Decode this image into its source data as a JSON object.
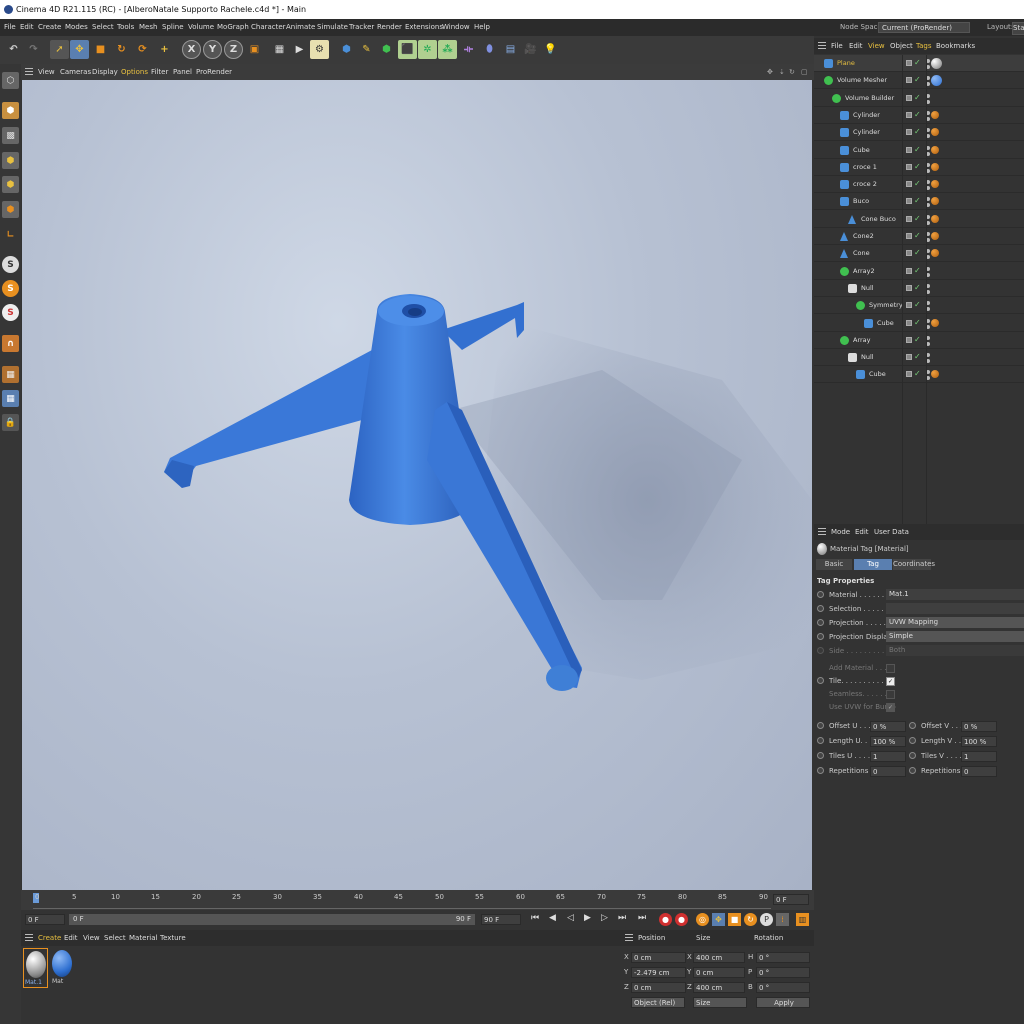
{
  "window": {
    "title": "Cinema 4D R21.115 (RC) - [AlberoNatale Supporto Rachele.c4d *] - Main"
  },
  "menu": {
    "items": [
      "File",
      "Edit",
      "Create",
      "Modes",
      "Select",
      "Tools",
      "Mesh",
      "Spline",
      "Volume",
      "MoGraph",
      "Character",
      "Animate",
      "Simulate",
      "Tracker",
      "Render",
      "Extensions",
      "Window",
      "Help"
    ],
    "node_space_label": "Node Space:",
    "node_space_value": "Current (ProRender)",
    "layout_label": "Layout:",
    "layout_value": "Star"
  },
  "toolbar": {
    "axis": [
      "X",
      "Y",
      "Z"
    ],
    "colors": {
      "active": "#5a7fb0",
      "yellow": "#e8c040",
      "orange": "#e89020",
      "blue": "#4a8fd8",
      "green": "#40c050"
    }
  },
  "left_tools": {
    "icons": [
      "make-editable-icon",
      "model-mode-icon",
      "texture-mode-icon",
      "points-mode-icon",
      "edges-mode-icon",
      "polygons-mode-icon",
      "axis-mode-icon",
      "snap-s-icon",
      "snap-s-icon",
      "snap-s-icon",
      "magnet-icon",
      "grid-icon",
      "grid-icon",
      "lock-icon"
    ],
    "snap_glyph": "S"
  },
  "viewport": {
    "menu": [
      "View",
      "Cameras",
      "Display",
      "Options",
      "Filter",
      "Panel",
      "ProRender"
    ],
    "object_color": "#3f7fd6"
  },
  "timeline": {
    "ticks": [
      "0",
      "5",
      "10",
      "15",
      "20",
      "25",
      "30",
      "35",
      "40",
      "45",
      "50",
      "55",
      "60",
      "65",
      "70",
      "75",
      "80",
      "85",
      "90"
    ],
    "current_frame_field": "0 F",
    "start_frame": "0 F",
    "range_start": "0 F",
    "range_end": "90 F",
    "end_frame": "90 F"
  },
  "material_manager": {
    "menu": [
      "Create",
      "Edit",
      "View",
      "Select",
      "Material",
      "Texture"
    ],
    "materials": [
      {
        "name": "Mat.1",
        "color": "#d0d0d0"
      },
      {
        "name": "Mat",
        "color": "#2e6fd0"
      }
    ]
  },
  "coordinates": {
    "headers": [
      "Position",
      "Size",
      "Rotation"
    ],
    "rows": [
      {
        "axis": "X",
        "pos": "0 cm",
        "size_axis": "X",
        "size": "400 cm",
        "rot_axis": "H",
        "rot": "0 °"
      },
      {
        "axis": "Y",
        "pos": "-2.479 cm",
        "size_axis": "Y",
        "size": "0 cm",
        "rot_axis": "P",
        "rot": "0 °"
      },
      {
        "axis": "Z",
        "pos": "0 cm",
        "size_axis": "Z",
        "size": "400 cm",
        "rot_axis": "B",
        "rot": "0 °"
      }
    ],
    "mode": "Object (Rel)",
    "size_mode": "Size",
    "apply": "Apply"
  },
  "object_manager": {
    "menu": [
      "File",
      "Edit",
      "View",
      "Object",
      "Tags",
      "Bookmarks"
    ],
    "objects": [
      {
        "name": "Plane",
        "indent": 0,
        "icon": "plane-icon",
        "selected": true
      },
      {
        "name": "Volume Mesher",
        "indent": 0,
        "icon": "volume-mesher-icon"
      },
      {
        "name": "Volume Builder",
        "indent": 1,
        "icon": "volume-builder-icon"
      },
      {
        "name": "Cylinder",
        "indent": 2,
        "icon": "cylinder-icon"
      },
      {
        "name": "Cylinder",
        "indent": 2,
        "icon": "cylinder-icon"
      },
      {
        "name": "Cube",
        "indent": 2,
        "icon": "cube-icon"
      },
      {
        "name": "croce 1",
        "indent": 2,
        "icon": "cube-icon"
      },
      {
        "name": "croce 2",
        "indent": 2,
        "icon": "cube-icon"
      },
      {
        "name": "Buco",
        "indent": 2,
        "icon": "cylinder-icon"
      },
      {
        "name": "Cone Buco",
        "indent": 3,
        "icon": "cone-icon"
      },
      {
        "name": "Cone2",
        "indent": 2,
        "icon": "cone-icon"
      },
      {
        "name": "Cone",
        "indent": 2,
        "icon": "cone-icon"
      },
      {
        "name": "Array2",
        "indent": 2,
        "icon": "array-icon"
      },
      {
        "name": "Null",
        "indent": 3,
        "icon": "null-icon"
      },
      {
        "name": "Symmetry",
        "indent": 4,
        "icon": "symmetry-icon"
      },
      {
        "name": "Cube",
        "indent": 5,
        "icon": "cube-icon"
      },
      {
        "name": "Array",
        "indent": 2,
        "icon": "array-icon"
      },
      {
        "name": "Null",
        "indent": 3,
        "icon": "null-icon"
      },
      {
        "name": "Cube",
        "indent": 4,
        "icon": "cube-icon"
      }
    ]
  },
  "attributes": {
    "menu": [
      "Mode",
      "Edit",
      "User Data"
    ],
    "title": "Material Tag [Material]",
    "tabs": [
      "Basic",
      "Tag",
      "Coordinates"
    ],
    "section": "Tag Properties",
    "props": [
      {
        "label": "Material . . . . . . .",
        "value": "Mat.1"
      },
      {
        "label": "Selection . . . . . . ",
        "value": ""
      },
      {
        "label": "Projection . . . . . .",
        "value": "UVW Mapping"
      },
      {
        "label": "Projection Display",
        "value": "Simple"
      },
      {
        "label": "Side . . . . . . . . . .",
        "value": "Both",
        "disabled": true
      }
    ],
    "checks": [
      {
        "label": "Add Material . . . .",
        "checked": false,
        "disabled": true
      },
      {
        "label": "Tile. . . . . . . . . . .",
        "checked": true,
        "disabled": false
      },
      {
        "label": "Seamless. . . . . . .",
        "checked": false,
        "disabled": true
      },
      {
        "label": "Use UVW for Bump",
        "checked": true,
        "disabled": true
      }
    ],
    "pairs": [
      {
        "l1": "Offset U . . .",
        "v1": "0 %",
        "l2": "Offset V . . .",
        "v2": "0 %"
      },
      {
        "l1": "Length U. . .",
        "v1": "100 %",
        "l2": "Length V . . .",
        "v2": "100 %"
      },
      {
        "l1": "Tiles U . . . .",
        "v1": "1",
        "l2": "Tiles V . . . .",
        "v2": "1"
      },
      {
        "l1": "Repetitions U",
        "v1": "0",
        "l2": "Repetitions V",
        "v2": "0"
      }
    ]
  }
}
